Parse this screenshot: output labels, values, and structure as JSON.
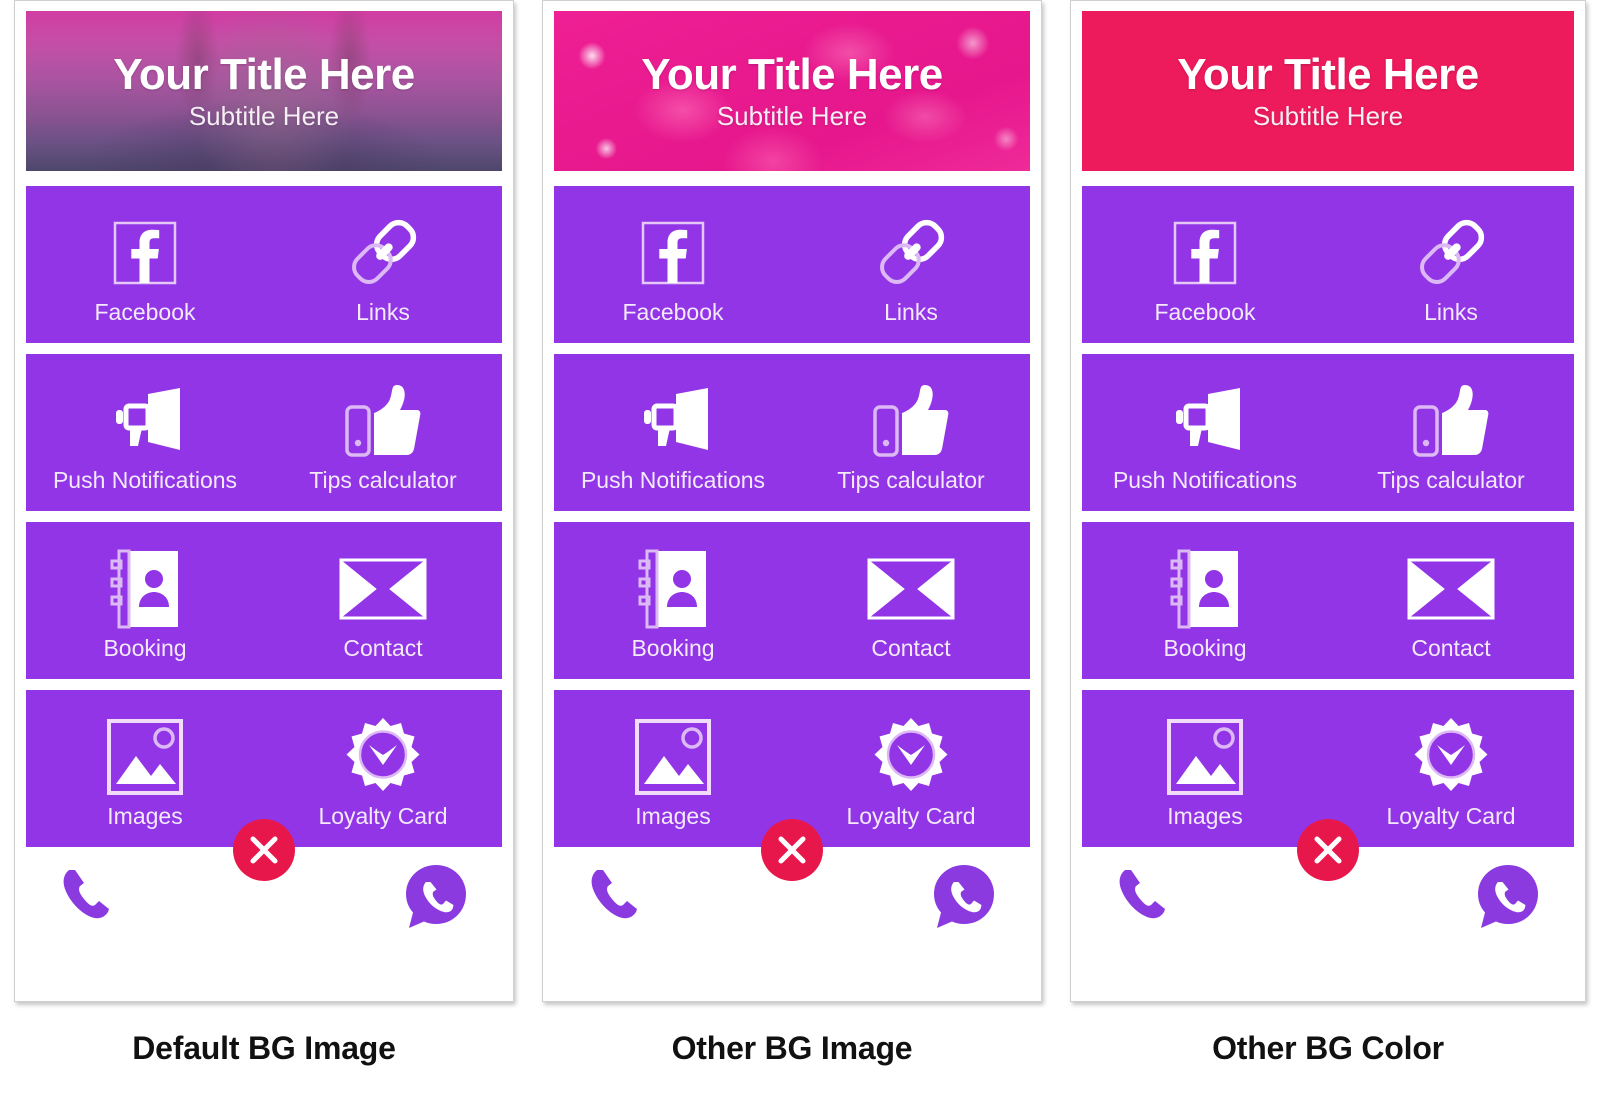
{
  "panels": [
    {
      "caption": "Default BG Image",
      "bg_style": "default-bg",
      "header": {
        "title": "Your Title Here",
        "subtitle": "Subtitle Here"
      }
    },
    {
      "caption": "Other BG Image",
      "bg_style": "floral-bg",
      "header": {
        "title": "Your Title Here",
        "subtitle": "Subtitle Here"
      }
    },
    {
      "caption": "Other BG Color",
      "bg_style": "solid-bg",
      "header": {
        "title": "Your Title Here",
        "subtitle": "Subtitle Here"
      }
    }
  ],
  "menu": {
    "rows": [
      [
        {
          "label": "Facebook",
          "icon": "facebook-icon"
        },
        {
          "label": "Links",
          "icon": "link-chain-icon"
        }
      ],
      [
        {
          "label": "Push Notifications",
          "icon": "megaphone-icon"
        },
        {
          "label": "Tips calculator",
          "icon": "thumbs-up-icon"
        }
      ],
      [
        {
          "label": "Booking",
          "icon": "address-book-icon"
        },
        {
          "label": "Contact",
          "icon": "envelope-icon"
        }
      ],
      [
        {
          "label": "Images",
          "icon": "picture-icon"
        },
        {
          "label": "Loyalty Card",
          "icon": "badge-check-icon"
        }
      ]
    ]
  },
  "footer": {
    "phone_icon": "phone-handset-icon",
    "whatsapp_icon": "whatsapp-icon",
    "close_icon": "close-x-icon"
  },
  "colors": {
    "tile_purple": "#9135e6",
    "close_red": "#e8174b",
    "solid_header_pink": "#ed1a5c",
    "floral_header_pink": "#e81a8e",
    "label_white": "#f4e9fb"
  }
}
